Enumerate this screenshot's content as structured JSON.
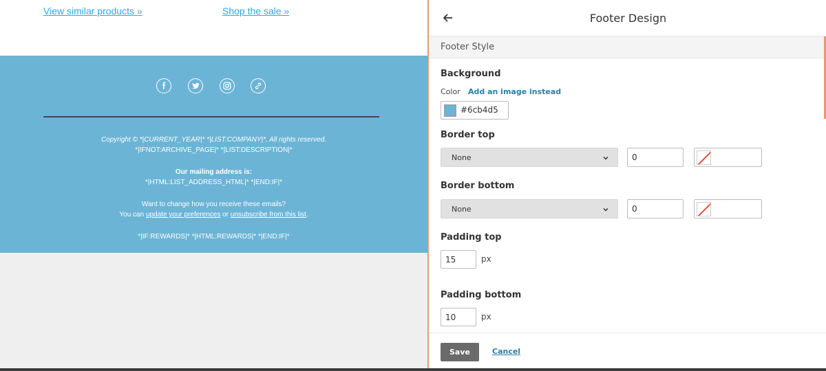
{
  "preview": {
    "links": [
      "View similar products »",
      "Shop the sale »"
    ],
    "footer_bg": "#6cb4d5",
    "social_icons": [
      "facebook-icon",
      "twitter-icon",
      "instagram-icon",
      "link-icon"
    ],
    "copyright_line1": "Copyright © *|CURRENT_YEAR|* *|LIST:COMPANY|*, All rights reserved.",
    "copyright_line2": "*|IFNOT:ARCHIVE_PAGE|* *|LIST:DESCRIPTION|*",
    "mailing_heading": "Our mailing address is:",
    "mailing_address": "*|HTML:LIST_ADDRESS_HTML|* *|END:IF|*",
    "change_line": "Want to change how you receive these emails?",
    "you_can": "You can ",
    "update_prefs": "update your preferences",
    "or_text": " or ",
    "unsubscribe": "unsubscribe from this list",
    "period": ".",
    "rewards": "*|IF:REWARDS|* *|HTML:REWARDS|* *|END:IF|*"
  },
  "panel": {
    "title": "Footer Design",
    "section": "Footer Style",
    "background_label": "Background",
    "color_label": "Color",
    "add_image_link": "Add an image instead",
    "bg_color_value": "#6cb4d5",
    "border_top_label": "Border top",
    "border_top_style": "None",
    "border_top_width": "0",
    "border_bottom_label": "Border bottom",
    "border_bottom_style": "None",
    "border_bottom_width": "0",
    "padding_top_label": "Padding top",
    "padding_top_value": "15",
    "padding_bottom_label": "Padding bottom",
    "padding_bottom_value": "10",
    "unit": "px",
    "save_label": "Save",
    "cancel_label": "Cancel"
  },
  "colors": {
    "accent": "#e69a72",
    "link": "#2baadf",
    "panel_link": "#2a7fa6",
    "save_bg": "#6a6a6a"
  }
}
